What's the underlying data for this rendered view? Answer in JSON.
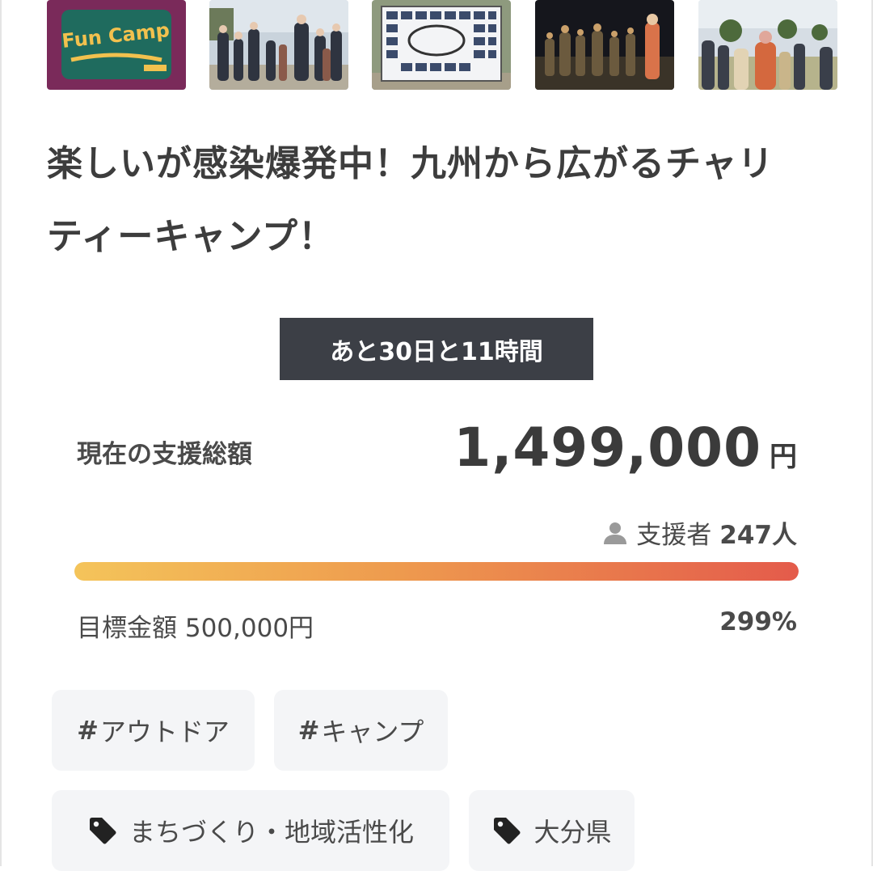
{
  "project": {
    "title": "楽しいが感染爆発中！九州から広がるチャリティーキャンプ！",
    "countdown": "あと30日と11時間"
  },
  "gallery": {
    "images": [
      {
        "name": "fun-camp-logo-image"
      },
      {
        "name": "participants-group-photo"
      },
      {
        "name": "sponsor-banner-photo"
      },
      {
        "name": "night-event-photo"
      },
      {
        "name": "outdoor-crowd-photo"
      }
    ],
    "logo_text": "Fun Camp"
  },
  "funding": {
    "total_label": "現在の支援総額",
    "total_amount": "1,499,000",
    "currency_unit": "円",
    "supporters_label": "支援者",
    "supporters_count": "247人",
    "goal_label": "目標金額 500,000円",
    "percent_label": "299%",
    "progress_fraction": 1.0
  },
  "tags": {
    "hashtags": [
      {
        "hash": "#",
        "label": "アウトドア"
      },
      {
        "hash": "#",
        "label": "キャンプ"
      }
    ],
    "categories": [
      {
        "label": "まちづくり・地域活性化"
      },
      {
        "label": "大分県"
      }
    ]
  },
  "icons": {
    "person": "person-icon",
    "tag": "tag-icon"
  },
  "colors": {
    "countdown_bg": "#3c3f46",
    "progress_start": "#f4c45a",
    "progress_end": "#e45b4b",
    "tag_bg": "#f4f5f7"
  }
}
